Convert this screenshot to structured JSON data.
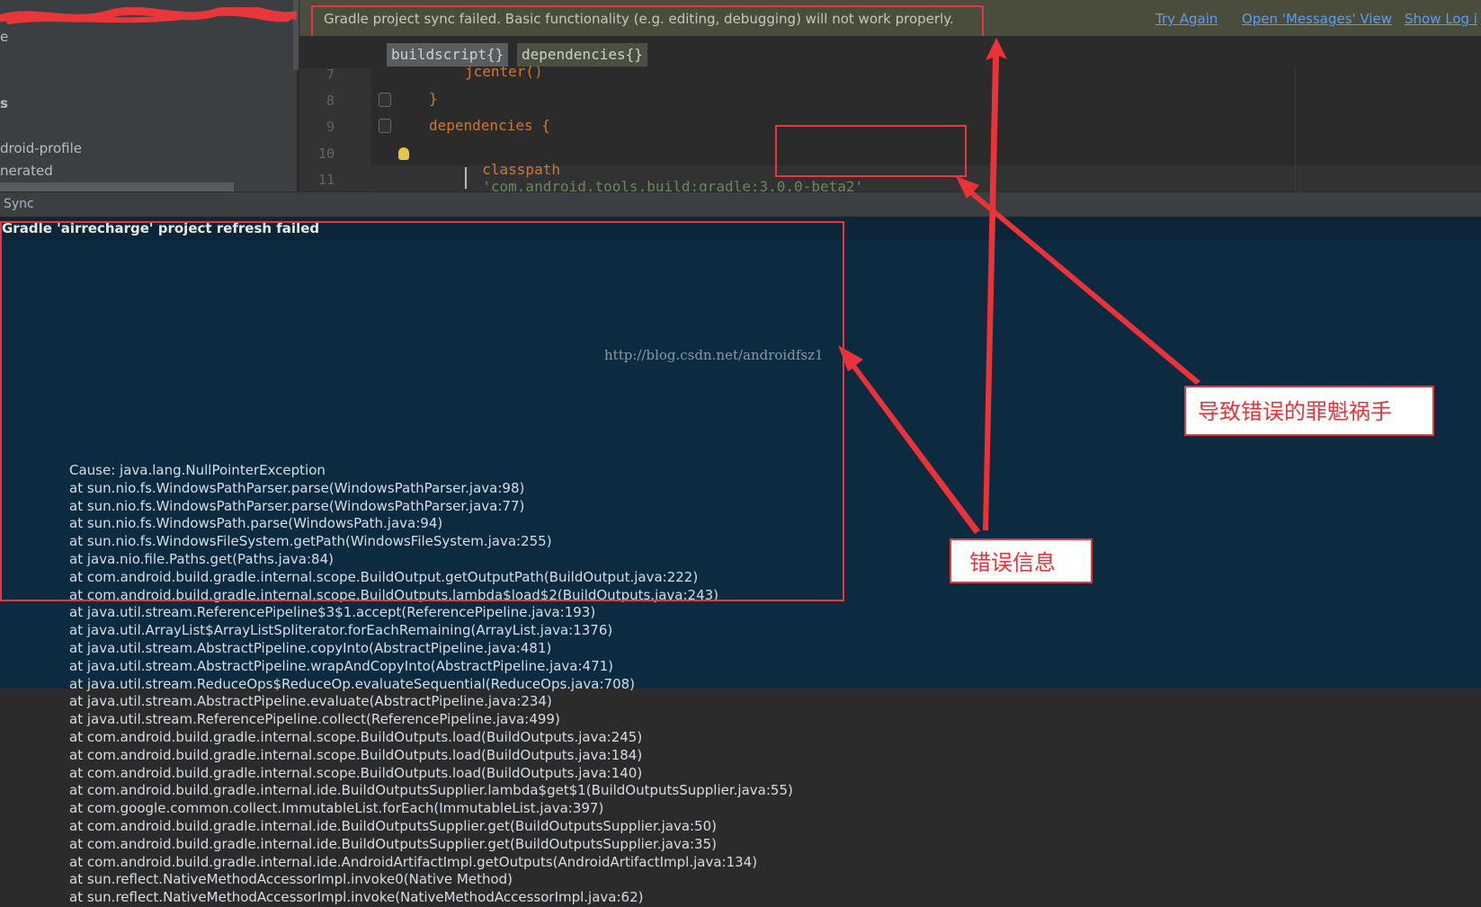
{
  "left_panel": {
    "items": [
      "e",
      "s",
      "droid-profile",
      "nerated"
    ]
  },
  "notification": {
    "message": "Gradle project sync failed. Basic functionality (e.g. editing, debugging) will not work properly.",
    "links": [
      "Try Again",
      "Open 'Messages' View",
      "Show Log i"
    ]
  },
  "breadcrumbs": [
    "buildscript{}",
    "dependencies{}"
  ],
  "editor": {
    "lines": [
      {
        "num": "7",
        "text": "jcenter()"
      },
      {
        "num": "8",
        "text": "}"
      },
      {
        "num": "9",
        "text": "dependencies {"
      },
      {
        "num": "10",
        "keyword": "classpath",
        "string": "'com.android.tools.build:gradle:3.0.0-beta2'"
      },
      {
        "num": "11",
        "text": ""
      }
    ]
  },
  "sync": {
    "title": "Sync",
    "failed_title": "Gradle 'airrecharge' project refresh failed",
    "trace": [
      "Cause: java.lang.NullPointerException",
      "at sun.nio.fs.WindowsPathParser.parse(WindowsPathParser.java:98)",
      "at sun.nio.fs.WindowsPathParser.parse(WindowsPathParser.java:77)",
      "at sun.nio.fs.WindowsPath.parse(WindowsPath.java:94)",
      "at sun.nio.fs.WindowsFileSystem.getPath(WindowsFileSystem.java:255)",
      "at java.nio.file.Paths.get(Paths.java:84)",
      "at com.android.build.gradle.internal.scope.BuildOutput.getOutputPath(BuildOutput.java:222)",
      "at com.android.build.gradle.internal.scope.BuildOutputs.lambda$load$2(BuildOutputs.java:243)",
      "at java.util.stream.ReferencePipeline$3$1.accept(ReferencePipeline.java:193)",
      "at java.util.ArrayList$ArrayListSpliterator.forEachRemaining(ArrayList.java:1376)",
      "at java.util.stream.AbstractPipeline.copyInto(AbstractPipeline.java:481)",
      "at java.util.stream.AbstractPipeline.wrapAndCopyInto(AbstractPipeline.java:471)",
      "at java.util.stream.ReduceOps$ReduceOp.evaluateSequential(ReduceOps.java:708)",
      "at java.util.stream.AbstractPipeline.evaluate(AbstractPipeline.java:234)",
      "at java.util.stream.ReferencePipeline.collect(ReferencePipeline.java:499)",
      "at com.android.build.gradle.internal.scope.BuildOutputs.load(BuildOutputs.java:245)",
      "at com.android.build.gradle.internal.scope.BuildOutputs.load(BuildOutputs.java:184)",
      "at com.android.build.gradle.internal.scope.BuildOutputs.load(BuildOutputs.java:140)",
      "at com.android.build.gradle.internal.ide.BuildOutputsSupplier.lambda$get$1(BuildOutputsSupplier.java:55)",
      "at com.google.common.collect.ImmutableList.forEach(ImmutableList.java:397)",
      "at com.android.build.gradle.internal.ide.BuildOutputsSupplier.get(BuildOutputsSupplier.java:50)",
      "at com.android.build.gradle.internal.ide.BuildOutputsSupplier.get(BuildOutputsSupplier.java:35)",
      "at com.android.build.gradle.internal.ide.AndroidArtifactImpl.getOutputs(AndroidArtifactImpl.java:134)",
      "at sun.reflect.NativeMethodAccessorImpl.invoke0(Native Method)",
      "at sun.reflect.NativeMethodAccessorImpl.invoke(NativeMethodAccessorImpl.java:62)"
    ]
  },
  "watermark": "http://blog.csdn.net/androidfsz1",
  "annotations": {
    "culprit_label": "导致错误的罪魁祸手",
    "error_info_label": "错误信息"
  },
  "colors": {
    "annotation_red": "#e8363b",
    "link": "#589df6",
    "console_bg": "#0d2b40"
  }
}
